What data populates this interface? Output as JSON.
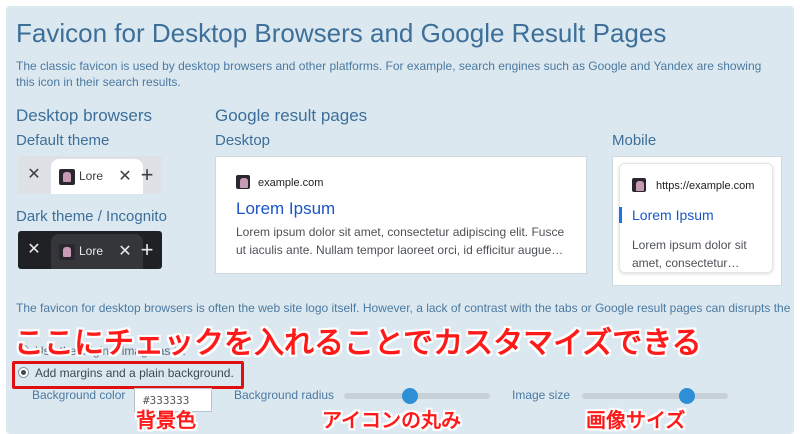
{
  "title": "Favicon for Desktop Browsers and Google Result Pages",
  "intro": "The classic favicon is used by desktop browsers and other platforms. For example, search engines such as Google and Yandex are showing this icon in their search results.",
  "desktop": {
    "heading": "Desktop browsers",
    "default_theme": "Default theme",
    "dark_theme": "Dark theme / Incognito",
    "tab_label": "Lore",
    "close_glyph": "✕",
    "plus_glyph": "+"
  },
  "google": {
    "heading": "Google result pages",
    "desktop_label": "Desktop",
    "desktop_site": "example.com",
    "desktop_title": "Lorem Ipsum",
    "desktop_snippet_1": "Lorem ipsum dolor sit amet, consectetur adipiscing elit. Fusce",
    "desktop_snippet_2": "ut iaculis ante. Nullam tempor laoreet orci, id efficitur augue…",
    "mobile_label": "Mobile",
    "mobile_site": "https://example.com",
    "mobile_title": "Lorem Ipsum",
    "mobile_snippet_1": "Lorem ipsum dolor sit",
    "mobile_snippet_2": "amet, consectetur…",
    "mobile_accent_color": "#1a73e8"
  },
  "note": "The favicon for desktop browsers is often the web site logo itself. However, a lack of contrast with the tabs or Google result pages can disrupts the",
  "options": {
    "use_original": "Use the original image as is.",
    "add_margins": "Add margins and a plain background.",
    "selected": "add_margins"
  },
  "controls": {
    "bg_color_label": "Background color",
    "bg_color_value": "#333333",
    "bg_radius_label": "Background radius",
    "bg_radius_value": 0.45,
    "image_size_label": "Image size",
    "image_size_value": 0.72
  },
  "annotations": {
    "main": "ここにチェックを入れることでカスタマイズできる",
    "color": "背景色",
    "radius": "アイコンの丸み",
    "size": "画像サイズ",
    "highlight_color": "#e01010"
  },
  "icons": {
    "favicon": "favicon-icon",
    "close": "close-icon",
    "new_tab": "plus-icon"
  }
}
